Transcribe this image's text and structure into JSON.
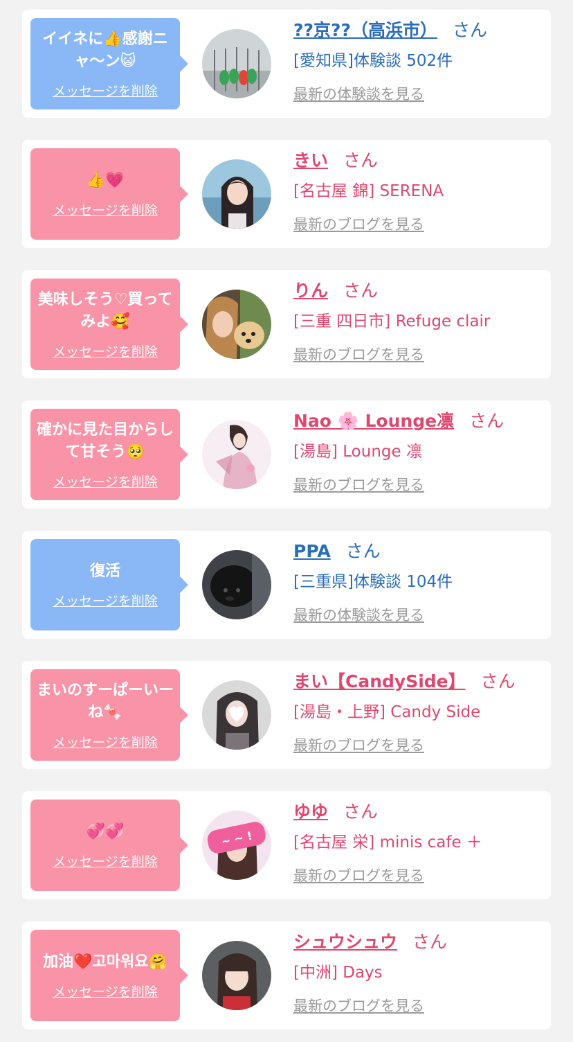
{
  "colors": {
    "blue_bubble": "#8ab8f7",
    "pink_bubble": "#f993a7",
    "blue_text": "#2a6db8",
    "pink_text": "#e0476e",
    "link_gray": "#9a9a9a",
    "background": "#f2f2f2"
  },
  "items": [
    {
      "theme": "blue",
      "message": "イイネに👍感謝ニャ～ン😺",
      "delete_label": "メッセージを削除",
      "name": "??京??（高浜市）",
      "honorific": "さん",
      "subtitle": "[愛知県]体験談 502件",
      "link_label": "最新の体験談を見る",
      "avatar_icon": "parrots-photo"
    },
    {
      "theme": "pink",
      "message": "👍💗",
      "delete_label": "メッセージを削除",
      "name": "きい",
      "honorific": "さん",
      "subtitle": "[名古屋 錦] SERENA",
      "link_label": "最新のブログを見る",
      "avatar_icon": "woman-photo"
    },
    {
      "theme": "pink",
      "message": "美味しそう♡買ってみよ🥰",
      "delete_label": "メッセージを削除",
      "name": "りん",
      "honorific": "さん",
      "subtitle": "[三重 四日市] Refuge clair",
      "link_label": "最新のブログを見る",
      "avatar_icon": "woman-with-dog-photo"
    },
    {
      "theme": "pink",
      "message": "確かに見た目からして甘そう🥺",
      "delete_label": "メッセージを削除",
      "name": "Nao 🌸 Lounge凛",
      "honorific": "さん",
      "subtitle": "[湯島] Lounge 凛",
      "link_label": "最新のブログを見る",
      "avatar_icon": "kimono-photo"
    },
    {
      "theme": "blue",
      "message": "復活",
      "delete_label": "メッセージを削除",
      "name": "PPA",
      "honorific": "さん",
      "subtitle": "[三重県]体験談 104件",
      "link_label": "最新の体験談を見る",
      "avatar_icon": "black-dog-photo"
    },
    {
      "theme": "pink",
      "message": "まいのすーぱーいーね🍬",
      "delete_label": "メッセージを削除",
      "name": "まい【CandySide】",
      "honorific": "さん",
      "subtitle": "[湯島・上野] Candy Side",
      "link_label": "最新のブログを見る",
      "avatar_icon": "heart-face-photo"
    },
    {
      "theme": "pink",
      "message": "💞💞",
      "delete_label": "メッセージを削除",
      "name": "ゆゆ",
      "honorific": "さん",
      "subtitle": "[名古屋 栄] minis cafe ＋",
      "link_label": "最新のブログを見る",
      "avatar_icon": "irasshai-sign-photo"
    },
    {
      "theme": "pink",
      "message": "加油❤️고마워요🤗",
      "delete_label": "メッセージを削除",
      "name": "シュウシュウ",
      "honorific": "さん",
      "subtitle": "[中洲] Days",
      "link_label": "最新のブログを見る",
      "avatar_icon": "woman-bangs-photo"
    }
  ]
}
